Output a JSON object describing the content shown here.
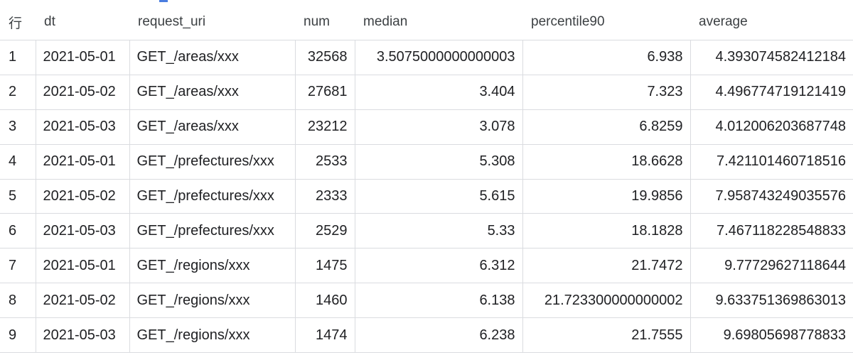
{
  "header": {
    "row": "行",
    "dt": "dt",
    "request_uri": "request_uri",
    "num": "num",
    "median": "median",
    "percentile90": "percentile90",
    "average": "average"
  },
  "rows": [
    {
      "row": "1",
      "dt": "2021-05-01",
      "request_uri": "GET_/areas/xxx",
      "num": "32568",
      "median": "3.5075000000000003",
      "percentile90": "6.938",
      "average": "4.393074582412184"
    },
    {
      "row": "2",
      "dt": "2021-05-02",
      "request_uri": "GET_/areas/xxx",
      "num": "27681",
      "median": "3.404",
      "percentile90": "7.323",
      "average": "4.496774719121419"
    },
    {
      "row": "3",
      "dt": "2021-05-03",
      "request_uri": "GET_/areas/xxx",
      "num": "23212",
      "median": "3.078",
      "percentile90": "6.8259",
      "average": "4.012006203687748"
    },
    {
      "row": "4",
      "dt": "2021-05-01",
      "request_uri": "GET_/prefectures/xxx",
      "num": "2533",
      "median": "5.308",
      "percentile90": "18.6628",
      "average": "7.421101460718516"
    },
    {
      "row": "5",
      "dt": "2021-05-02",
      "request_uri": "GET_/prefectures/xxx",
      "num": "2333",
      "median": "5.615",
      "percentile90": "19.9856",
      "average": "7.958743249035576"
    },
    {
      "row": "6",
      "dt": "2021-05-03",
      "request_uri": "GET_/prefectures/xxx",
      "num": "2529",
      "median": "5.33",
      "percentile90": "18.1828",
      "average": "7.467118228548833"
    },
    {
      "row": "7",
      "dt": "2021-05-01",
      "request_uri": "GET_/regions/xxx",
      "num": "1475",
      "median": "6.312",
      "percentile90": "21.7472",
      "average": "9.77729627118644"
    },
    {
      "row": "8",
      "dt": "2021-05-02",
      "request_uri": "GET_/regions/xxx",
      "num": "1460",
      "median": "6.138",
      "percentile90": "21.723300000000002",
      "average": "9.633751369863013"
    },
    {
      "row": "9",
      "dt": "2021-05-03",
      "request_uri": "GET_/regions/xxx",
      "num": "1474",
      "median": "6.238",
      "percentile90": "21.7555",
      "average": "9.69805698778833"
    }
  ],
  "colors": {
    "border": "#dadce0",
    "accent": "#4a7de0"
  }
}
